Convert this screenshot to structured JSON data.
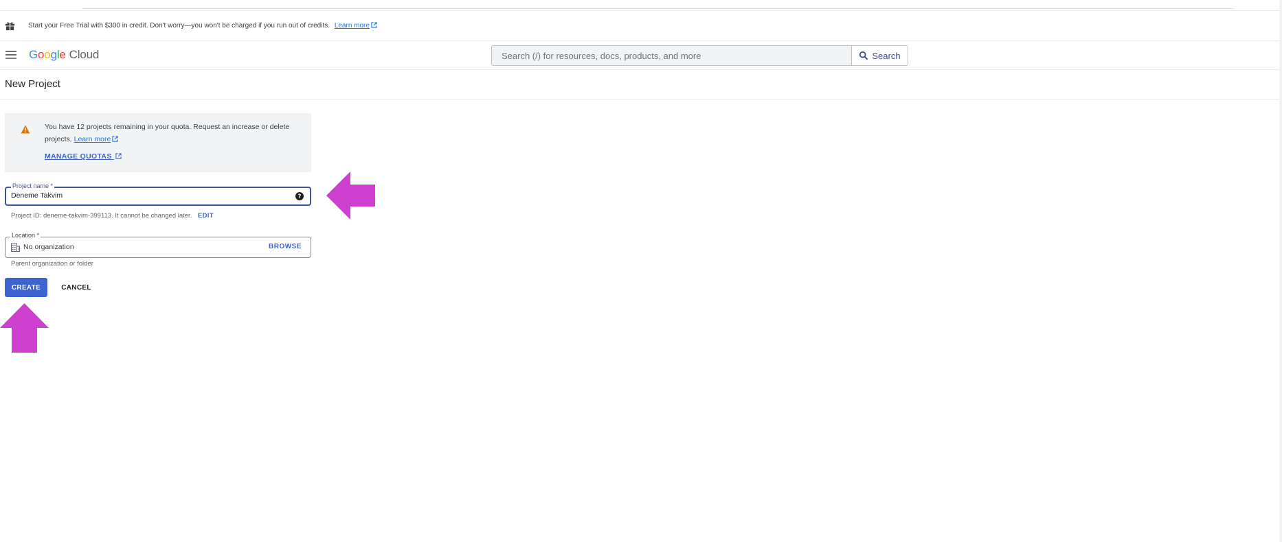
{
  "banner": {
    "text": "Start your Free Trial with $300 in credit. Don't worry—you won't be charged if you run out of credits.",
    "link": "Learn more"
  },
  "header": {
    "logo_google": "Google",
    "logo_cloud": "Cloud",
    "search_placeholder": "Search (/) for resources, docs, products, and more",
    "search_button": "Search"
  },
  "page": {
    "title": "New Project"
  },
  "quota": {
    "text": "You have 12 projects remaining in your quota. Request an increase or delete projects.",
    "learn_more": "Learn more",
    "manage_quotas": "MANAGE QUOTAS"
  },
  "form": {
    "project_name_label": "Project name *",
    "project_name_value": "Deneme Takvim",
    "project_id_text": "Project ID: deneme-takvim-399113. It cannot be changed later.",
    "edit_label": "EDIT",
    "location_label": "Location *",
    "location_value": "No organization",
    "browse_label": "BROWSE",
    "location_hint": "Parent organization or folder",
    "create_label": "CREATE",
    "cancel_label": "CANCEL"
  },
  "colors": {
    "primary": "#3c63cf",
    "annotation_arrow": "#cc3fcf",
    "warning": "#e37400"
  },
  "icons": [
    "gift-icon",
    "menu-icon",
    "search-icon",
    "warning-icon",
    "external-link-icon",
    "help-icon",
    "building-icon",
    "arrow-left-icon",
    "arrow-up-icon"
  ]
}
